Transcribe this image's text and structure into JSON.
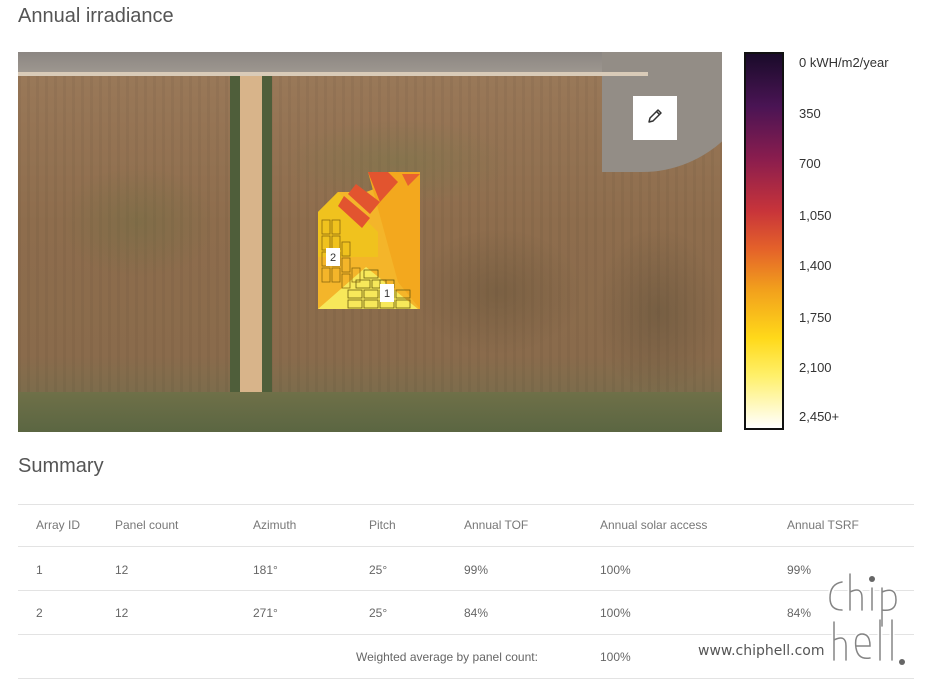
{
  "title": "Annual irradiance",
  "scale": {
    "labels": [
      "0 kWH/m2/year",
      "350",
      "700",
      "1,050",
      "1,400",
      "1,750",
      "2,100",
      "2,450+"
    ]
  },
  "map": {
    "array_labels": [
      "2",
      "1"
    ]
  },
  "summary": {
    "title": "Summary",
    "columns": [
      "Array ID",
      "Panel count",
      "Azimuth",
      "Pitch",
      "Annual TOF",
      "Annual solar access",
      "Annual TSRF"
    ],
    "rows": [
      [
        "1",
        "12",
        "181°",
        "25°",
        "99%",
        "100%",
        "99%"
      ],
      [
        "2",
        "12",
        "271°",
        "25°",
        "84%",
        "100%",
        "84%"
      ]
    ],
    "weighted_label": "Weighted average by panel count:",
    "weighted_value": "100%"
  },
  "watermark": "www.chiphell.com"
}
